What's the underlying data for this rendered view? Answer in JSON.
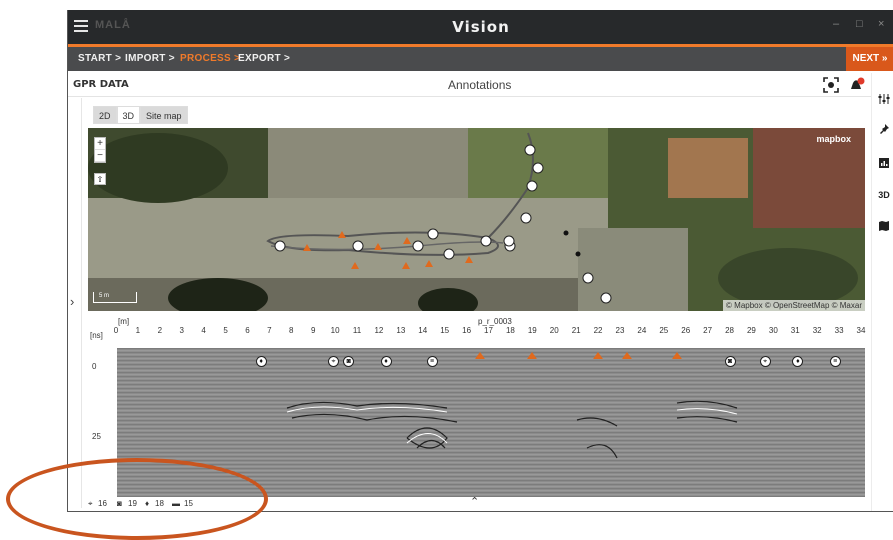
{
  "titlebar": {
    "brand": "MALÅ",
    "title": "Vision"
  },
  "window_controls": {
    "minimize": "–",
    "maximize": "□",
    "close": "×"
  },
  "steps": [
    {
      "label": "START >",
      "active": false
    },
    {
      "label": "IMPORT >",
      "active": false
    },
    {
      "label": "PROCESS >",
      "active": true
    },
    {
      "label": "EXPORT >",
      "active": false
    }
  ],
  "next_button": "NEXT »",
  "header": {
    "left": "GPR DATA",
    "title": "Annotations"
  },
  "notification_count": "1",
  "view_toggle": [
    "2D",
    "3D",
    "Site map"
  ],
  "right_tools": [
    "equalizer-icon",
    "pin-icon",
    "chart-icon",
    "3D",
    "map-icon"
  ],
  "right_tool_3d_label": "3D",
  "map": {
    "zoom_in": "+",
    "zoom_out": "−",
    "compass": "⇧",
    "logo": "mapbox",
    "attribution": "© Mapbox © OpenStreetMap © Maxar",
    "scale_label": "5 m"
  },
  "radargram": {
    "profile": "p_r_0003",
    "x_unit": "[m]",
    "y_unit": "[ns]",
    "x_ticks": [
      "0",
      "1",
      "2",
      "3",
      "4",
      "5",
      "6",
      "7",
      "8",
      "9",
      "10",
      "11",
      "12",
      "13",
      "14",
      "15",
      "16",
      "17",
      "18",
      "19",
      "20",
      "21",
      "22",
      "23",
      "24",
      "25",
      "26",
      "27",
      "28",
      "29",
      "30",
      "31",
      "32",
      "33",
      "34"
    ],
    "y_ticks": [
      "0",
      "25"
    ],
    "x_range": [
      0,
      34
    ],
    "annotations": [
      {
        "type": "gps",
        "x": 6.6
      },
      {
        "type": "target",
        "x": 9.9
      },
      {
        "type": "camera",
        "x": 10.6
      },
      {
        "type": "gps",
        "x": 12.3
      },
      {
        "type": "note",
        "x": 14.4
      },
      {
        "type": "marker",
        "x": 16.6
      },
      {
        "type": "marker",
        "x": 19.0
      },
      {
        "type": "marker",
        "x": 22.0
      },
      {
        "type": "marker",
        "x": 23.3
      },
      {
        "type": "marker",
        "x": 25.6
      },
      {
        "type": "camera",
        "x": 28.0
      },
      {
        "type": "target",
        "x": 29.6
      },
      {
        "type": "gps",
        "x": 31.1
      },
      {
        "type": "note",
        "x": 32.8
      }
    ]
  },
  "status": {
    "targets": "16",
    "photos": "19",
    "gps": "18",
    "markers": "15"
  },
  "colors": {
    "accent": "#f07a2a",
    "next": "#d9581b",
    "titlebar": "#27292b",
    "stepbar": "#4a4b4d",
    "highlight": "#c9551f"
  }
}
